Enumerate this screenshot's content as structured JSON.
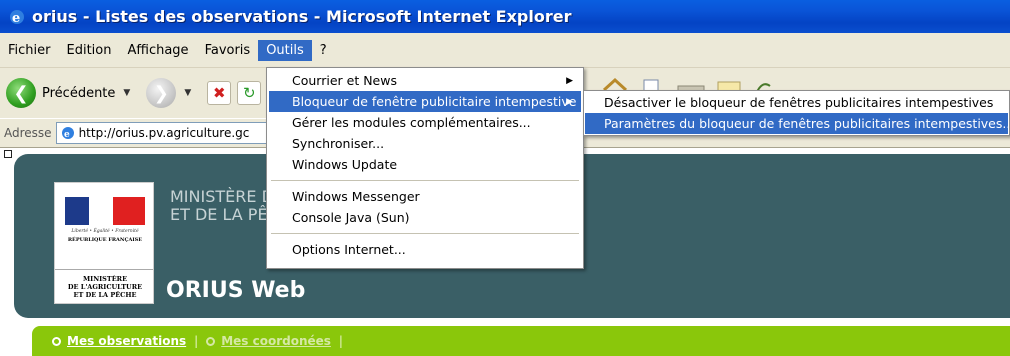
{
  "window": {
    "title": "orius - Listes des observations - Microsoft Internet Explorer"
  },
  "menubar": {
    "items": [
      "Fichier",
      "Edition",
      "Affichage",
      "Favoris",
      "Outils",
      "?"
    ],
    "active": "Outils"
  },
  "toolbar": {
    "back_label": "Précédente"
  },
  "addressbar": {
    "label": "Adresse",
    "url": "http://orius.pv.agriculture.gc"
  },
  "outils_menu": {
    "items": [
      {
        "label": "Courrier et News",
        "has_submenu": true
      },
      {
        "label": "Bloqueur de fenêtre publicitaire intempestive",
        "has_submenu": true,
        "highlighted": true
      },
      {
        "label": "Gérer les modules complémentaires..."
      },
      {
        "label": "Synchroniser..."
      },
      {
        "label": "Windows Update"
      },
      {
        "separator": true
      },
      {
        "label": "Windows Messenger"
      },
      {
        "label": "Console Java (Sun)"
      },
      {
        "separator": true
      },
      {
        "label": "Options Internet..."
      }
    ]
  },
  "submenu": {
    "items": [
      {
        "label": "Désactiver le bloqueur de fenêtres publicitaires intempestives"
      },
      {
        "label": "Paramètres du bloqueur de fenêtres publicitaires intempestives...",
        "highlighted": true
      }
    ]
  },
  "page": {
    "ministry_line1": "MINISTÈRE DE",
    "ministry_line2": "ET DE LA PÊCH",
    "app_name": "ORIUS Web",
    "logo_motto": "Liberté • Égalité • Fraternité",
    "logo_republique": "RÉPUBLIQUE FRANÇAISE",
    "logo_ministere_1": "MINISTÈRE",
    "logo_ministere_2": "DE L'AGRICULTURE",
    "logo_ministere_3": "ET DE LA PÊCHE",
    "nav": {
      "links": [
        "Mes observations",
        "Mes coordonées"
      ],
      "separator": "|"
    }
  },
  "colors": {
    "title_bar": "#0a55d8",
    "menu_highlight": "#316ac5",
    "banner": "#3a5f66",
    "nav_bar": "#8ac70b"
  }
}
